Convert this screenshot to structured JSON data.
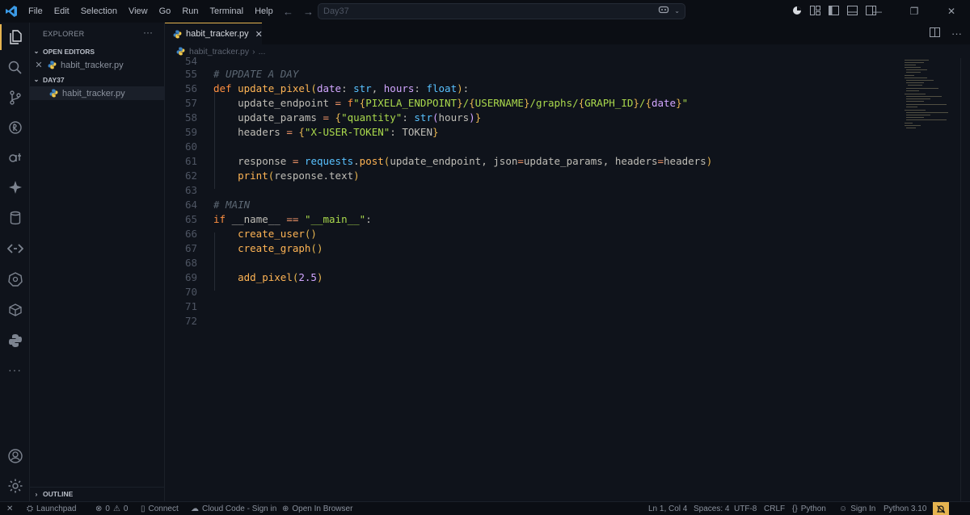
{
  "menu": [
    "File",
    "Edit",
    "Selection",
    "View",
    "Go",
    "Run",
    "Terminal",
    "Help"
  ],
  "search": {
    "placeholder": "Day37"
  },
  "sidebar": {
    "title": "EXPLORER",
    "open_editors_label": "OPEN EDITORS",
    "open_editor_file": "habit_tracker.py",
    "folder_label": "DAY37",
    "folder_file": "habit_tracker.py",
    "outline_label": "OUTLINE"
  },
  "tab": {
    "label": "habit_tracker.py"
  },
  "breadcrumb": {
    "file": "habit_tracker.py",
    "rest": "..."
  },
  "code": {
    "line_numbers": [
      "54",
      "55",
      "56",
      "57",
      "58",
      "59",
      "60",
      "61",
      "62",
      "63",
      "64",
      "65",
      "66",
      "67",
      "68",
      "69",
      "70",
      "71",
      "72"
    ],
    "l55": "# UPDATE A DAY",
    "l56": {
      "def": "def",
      "name": "update_pixel",
      "p1": "date",
      "t1": "str",
      "p2": "hours",
      "t2": "float"
    },
    "l57": {
      "var": "update_endpoint",
      "s1": "\"",
      "e1": "PIXELA_ENDPOINT",
      "e2": "USERNAME",
      "mid": "/graphs/",
      "e3": "GRAPH_ID",
      "e4": "date"
    },
    "l58": {
      "var": "update_params",
      "key": "\"quantity\"",
      "fn": "str",
      "arg": "hours"
    },
    "l59": {
      "var": "headers",
      "key": "\"X-USER-TOKEN\"",
      "val": "TOKEN"
    },
    "l61": {
      "var": "response",
      "mod": "requests",
      "fn": "post",
      "a1": "update_endpoint",
      "k1": "json",
      "v1": "update_params",
      "k2": "headers",
      "v2": "headers"
    },
    "l62": {
      "fn": "print",
      "arg": "response.text"
    },
    "l64": "# MAIN",
    "l65": {
      "kw": "if",
      "name": "__name__",
      "op": "==",
      "str": "\"__main__\""
    },
    "l66": "create_user",
    "l67": "create_graph",
    "l69": {
      "fn": "add_pixel",
      "num": "2.5"
    }
  },
  "status": {
    "launchpad": "Launchpad",
    "errors": "0",
    "warnings": "0",
    "connect": "Connect",
    "cloud": "Cloud Code - Sign in",
    "browser": "Open In Browser",
    "position": "Ln 1, Col 4",
    "spaces": "Spaces: 4",
    "encoding": "UTF-8",
    "eol": "CRLF",
    "language": "Python",
    "signin": "Sign In",
    "interpreter": "Python 3.10"
  },
  "colors": {
    "accent": "#e6b450",
    "background": "#0f131b",
    "keyword": "#ff8f40",
    "function": "#ffb454",
    "string": "#aad94c"
  }
}
